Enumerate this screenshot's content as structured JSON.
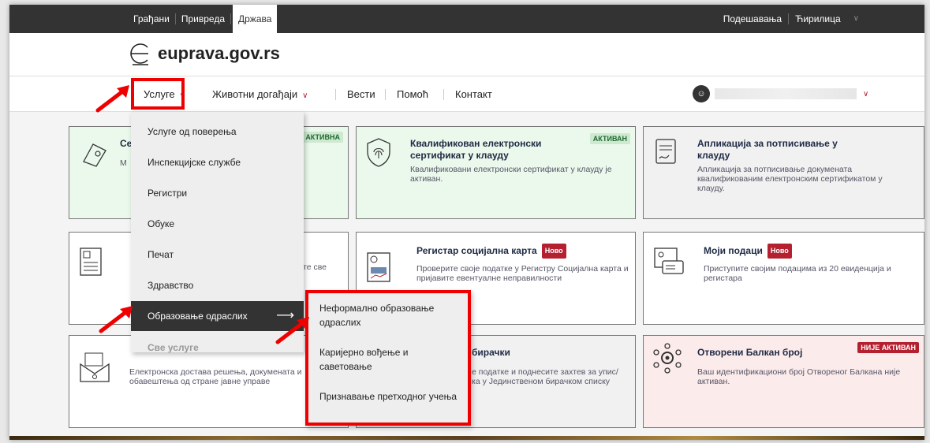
{
  "topbar": {
    "links": [
      "Грађани",
      "Привреда",
      "Држава"
    ],
    "settings": "Подешавања",
    "language": "Ћирилица"
  },
  "logo": {
    "text": "euprava.gov.rs"
  },
  "nav": {
    "items": [
      "Услуге",
      "Животни догађаји",
      "Вести",
      "Помоћ",
      "Контакт"
    ]
  },
  "menu": {
    "items": [
      "Услуге од поверења",
      "Инспекцијске службе",
      "Регистри",
      "Обуке",
      "Печат",
      "Здравство",
      "Образовање одраслих",
      "Све услуге"
    ],
    "arrow": "⟶"
  },
  "submenu": {
    "items": [
      "Неформално образовање одраслих",
      "Каријерно вођење и саветовање",
      "Признавање претходног учења"
    ]
  },
  "cards": {
    "c1": {
      "title": "Се",
      "desc": "М",
      "badge": "АКТИВНА"
    },
    "c2": {
      "title": "Квалификован електронски сертификат у клауду",
      "desc": "Квалификовани електронски сертификат у клауду је активан.",
      "badge": "АКТИВАН"
    },
    "c3": {
      "title": "Апликација за потписивање у клауду",
      "desc": "Апликација за потписивање докумената квалификованим електронским сертификатом у клауду."
    },
    "c4": {
      "desc": "те све"
    },
    "c5": {
      "title": "Регистар социјална карта",
      "badge": "Ново",
      "desc": "Проверите своје податке у Регистру Социјална карта и пријавите евентуалне неправилности"
    },
    "c6": {
      "title": "Моји подаци",
      "badge": "Ново",
      "desc": "Приступите својим подацима из 20 евиденција и регистара"
    },
    "c7": {
      "desc": "Електронска достава решења, докумената и обавештења од стране јавне управе"
    },
    "c8": {
      "title": "бирачки",
      "desc": "е податке и поднесите захтев за упис/ ка у Јединственом бирачком списку"
    },
    "c9": {
      "title": "Отворени Балкан број",
      "badge": "НИЈЕ АКТИВАН",
      "desc": "Ваш идентификациони број Отвореног Балкана није активан."
    }
  }
}
